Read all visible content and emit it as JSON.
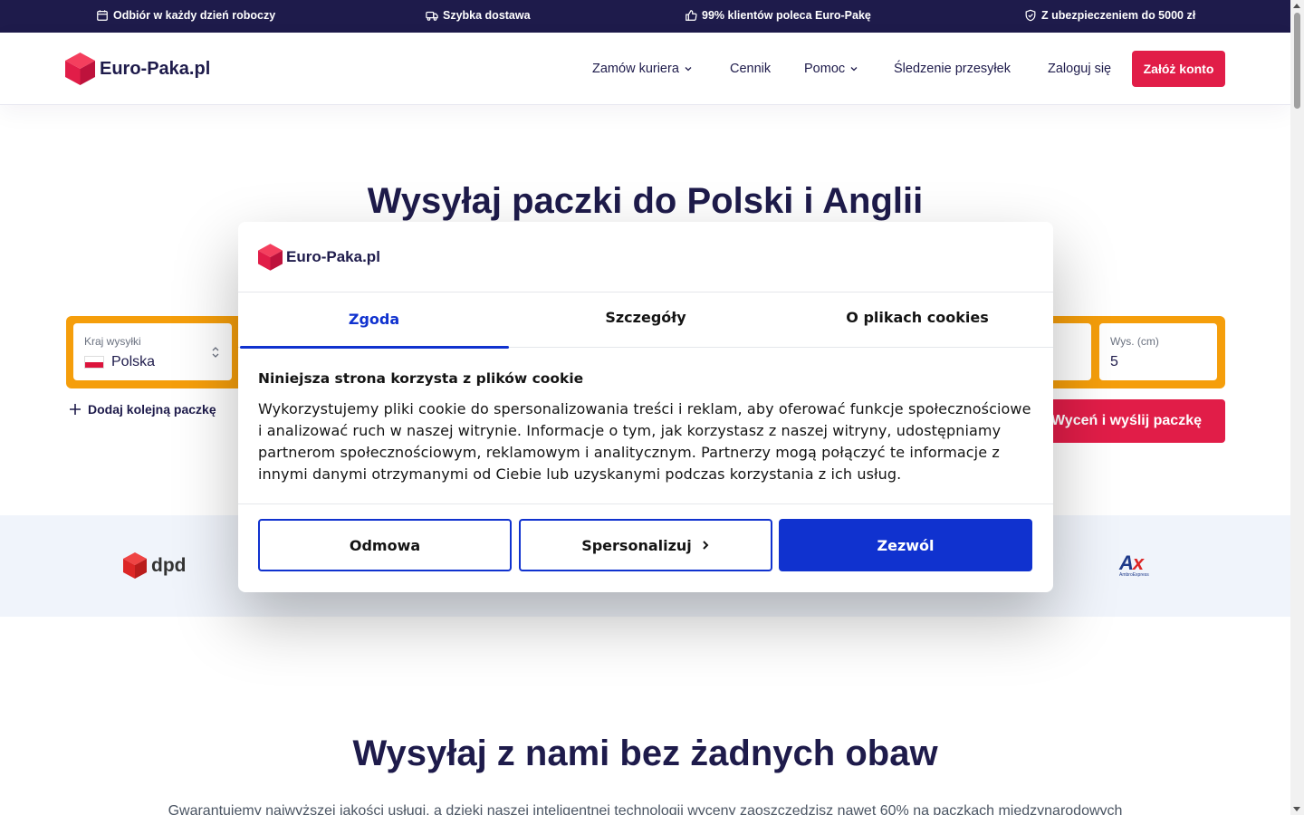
{
  "topbar": {
    "items": [
      {
        "icon": "calendar-icon",
        "text": "Odbiór w każdy dzień roboczy"
      },
      {
        "icon": "truck-icon",
        "text": "Szybka dostawa"
      },
      {
        "icon": "thumbs-up-icon",
        "text": "99% klientów poleca Euro-Pakę"
      },
      {
        "icon": "shield-check-icon",
        "text": "Z ubezpieczeniem do 5000 zł"
      }
    ]
  },
  "header": {
    "logo_text": "Euro-Paka.pl",
    "nav": {
      "order": "Zamów kuriera",
      "pricing": "Cennik",
      "help": "Pomoc",
      "tracking": "Śledzenie przesyłek",
      "login": "Zaloguj się"
    },
    "cta": "Załóż konto"
  },
  "hero": {
    "title": "Wysyłaj paczki do Polski i Anglii",
    "form": {
      "country_label": "Kraj wysyłki",
      "country_value": "Polska",
      "height_label": "Wys. (cm)",
      "height_value": "5"
    },
    "add_package": "Dodaj kolejną paczkę",
    "quote_button": "Wyceń i wyślij paczkę"
  },
  "carriers": {
    "dpd": "dpd",
    "ambro_main": "A",
    "ambro_x": "x",
    "ambro_sub": "AmbroExpress"
  },
  "section": {
    "title": "Wysyłaj z nami bez żadnych obaw",
    "text": "Gwarantujemy najwyższej jakości usługi, a dzięki naszej inteligentnej technologii wyceny zaoszczędzisz nawet 60% na paczkach międzynarodowych"
  },
  "cookie_modal": {
    "logo_text": "Euro-Paka.pl",
    "tabs": [
      "Zgoda",
      "Szczegóły",
      "O plikach cookies"
    ],
    "heading": "Niniejsza strona korzysta z plików cookie",
    "body": "Wykorzystujemy pliki cookie do spersonalizowania treści i reklam, aby oferować funkcje społecznościowe i analizować ruch w naszej witrynie. Informacje o tym, jak korzystasz z naszej witryny, udostępniamy partnerom społecznościowym, reklamowym i analitycznym. Partnerzy mogą połączyć te informacje z innymi danymi otrzymanymi od Ciebie lub uzyskanymi podczas korzystania z ich usług.",
    "buttons": {
      "deny": "Odmowa",
      "customize": "Spersonalizuj",
      "allow": "Zezwól"
    }
  },
  "colors": {
    "navy": "#1e1b4b",
    "brand_red": "#e11d48",
    "orange": "#f59e0b",
    "cookie_blue": "#1032cf"
  }
}
